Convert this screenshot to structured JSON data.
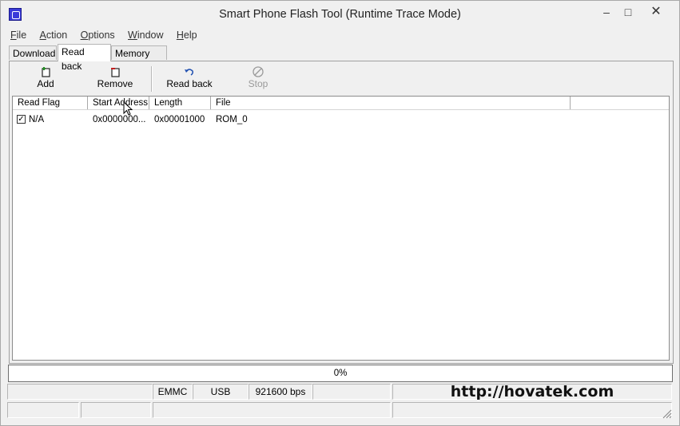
{
  "window": {
    "title": "Smart Phone Flash Tool (Runtime Trace Mode)",
    "minimize": "–",
    "maximize": "□",
    "close": "✕"
  },
  "menu": [
    "File",
    "Action",
    "Options",
    "Window",
    "Help"
  ],
  "tabs": [
    {
      "label": "Download",
      "active": false
    },
    {
      "label": "Read back",
      "active": true
    },
    {
      "label": "Memory Test",
      "active": false
    }
  ],
  "toolbar": {
    "add_label": "Add",
    "remove_label": "Remove",
    "readback_label": "Read back",
    "stop_label": "Stop"
  },
  "table": {
    "columns": [
      "Read Flag",
      "Start Address",
      "Length",
      "File"
    ],
    "rows": [
      {
        "checked": true,
        "read_flag": "N/A",
        "start_address": "0x0000000...",
        "length": "0x00001000",
        "file": "ROM_0"
      }
    ]
  },
  "progress": {
    "value": 0,
    "text": "0%"
  },
  "status": {
    "storage": "EMMC",
    "port": "USB",
    "baud": "921600 bps",
    "watermark": "http://hovatek.com"
  },
  "colors": {
    "progress_fill": "#3a7bd5",
    "add_icon": "#2a8a2a",
    "remove_icon": "#c41e1e",
    "readback_icon": "#2050b0"
  }
}
